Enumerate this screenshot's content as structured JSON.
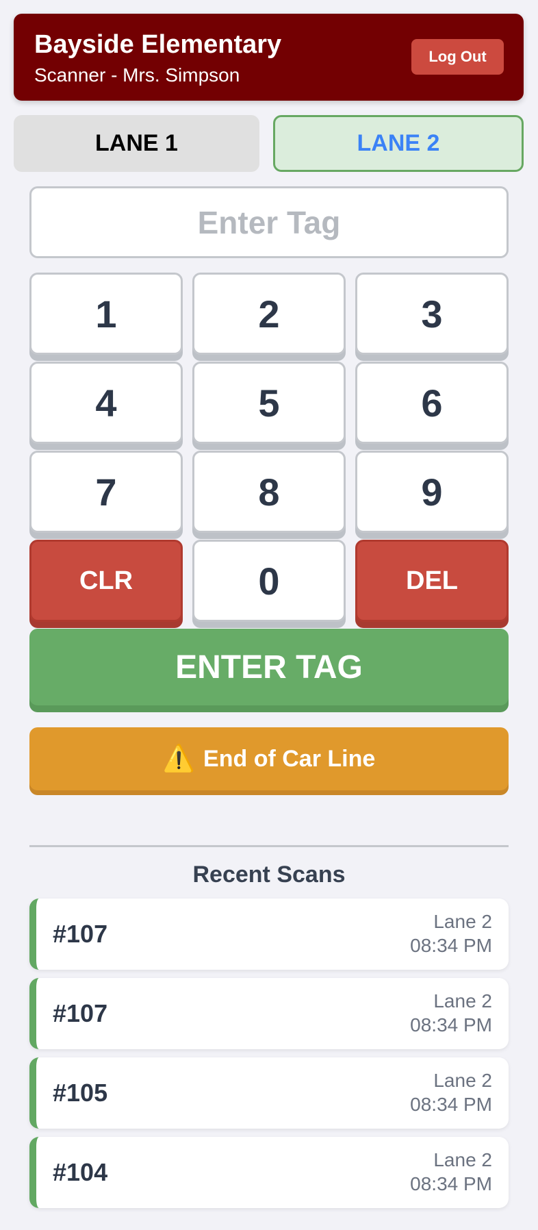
{
  "header": {
    "school_name": "Bayside Elementary",
    "scanner_label": "Scanner - Mrs. Simpson",
    "logout_label": "Log Out"
  },
  "lanes": {
    "lane1_label": "LANE 1",
    "lane2_label": "LANE 2",
    "selected": "LANE 2"
  },
  "input": {
    "placeholder": "Enter Tag",
    "value": ""
  },
  "keypad": {
    "k1": "1",
    "k2": "2",
    "k3": "3",
    "k4": "4",
    "k5": "5",
    "k6": "6",
    "k7": "7",
    "k8": "8",
    "k9": "9",
    "clr": "CLR",
    "k0": "0",
    "del": "DEL"
  },
  "actions": {
    "enter_label": "ENTER TAG",
    "end_label": "End of Car Line",
    "end_icon": "warning-icon"
  },
  "recent": {
    "title": "Recent Scans",
    "items": [
      {
        "tag": "#107",
        "lane": "Lane 2",
        "time": "08:34 PM"
      },
      {
        "tag": "#107",
        "lane": "Lane 2",
        "time": "08:34 PM"
      },
      {
        "tag": "#105",
        "lane": "Lane 2",
        "time": "08:34 PM"
      },
      {
        "tag": "#104",
        "lane": "Lane 2",
        "time": "08:34 PM"
      }
    ]
  },
  "colors": {
    "header_bg": "#730002",
    "danger": "#c84b3f",
    "success": "#67ac67",
    "warning": "#e0992c",
    "lane_selected_text": "#3b82f6"
  }
}
